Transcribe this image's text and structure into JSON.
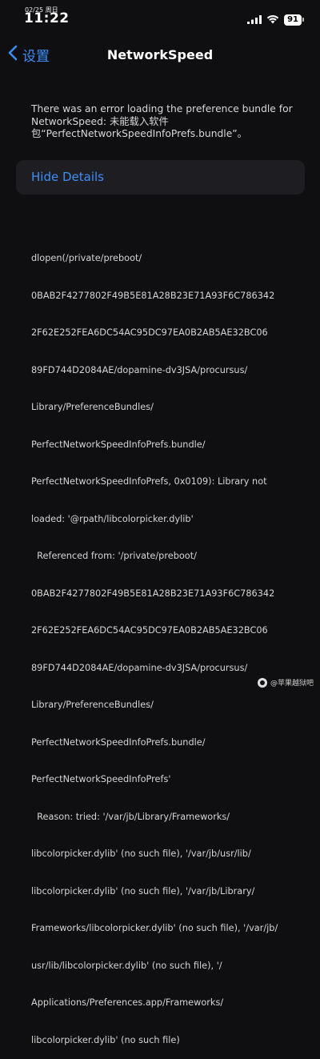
{
  "status_bar": {
    "date": "02/25 周日",
    "time": "11:22",
    "battery": "91"
  },
  "nav": {
    "back_label": "设置",
    "title": "NetworkSpeed"
  },
  "error_message": "There was an error loading the preference bundle for NetworkSpeed: 未能载入软件包“PerfectNetworkSpeedInfoPrefs.bundle”。",
  "hide_details_label": "Hide Details",
  "details_lines": [
    "dlopen(/private/preboot/",
    "0BAB2F4277802F49B5E81A28B23E71A93F6C786342",
    "2F62E252FEA6DC54AC95DC97EA0B2AB5AE32BC06",
    "89FD744D2084AE/dopamine-dv3JSA/procursus/",
    "Library/PreferenceBundles/",
    "PerfectNetworkSpeedInfoPrefs.bundle/",
    "PerfectNetworkSpeedInfoPrefs, 0x0109): Library not",
    "loaded: '@rpath/libcolorpicker.dylib'",
    "  Referenced from: '/private/preboot/",
    "0BAB2F4277802F49B5E81A28B23E71A93F6C786342",
    "2F62E252FEA6DC54AC95DC97EA0B2AB5AE32BC06",
    "89FD744D2084AE/dopamine-dv3JSA/procursus/",
    "Library/PreferenceBundles/",
    "PerfectNetworkSpeedInfoPrefs.bundle/",
    "PerfectNetworkSpeedInfoPrefs'",
    "  Reason: tried: '/var/jb/Library/Frameworks/",
    "libcolorpicker.dylib' (no such file), '/var/jb/usr/lib/",
    "libcolorpicker.dylib' (no such file), '/var/jb/Library/",
    "Frameworks/libcolorpicker.dylib' (no such file), '/var/jb/",
    "usr/lib/libcolorpicker.dylib' (no such file), '/",
    "Applications/Preferences.app/Frameworks/",
    "libcolorpicker.dylib' (no such file)"
  ],
  "watermark": "@苹果越狱吧",
  "colors": {
    "accent": "#3d8ef7",
    "background": "#0f0f11",
    "button_bg": "#1e1e22"
  }
}
